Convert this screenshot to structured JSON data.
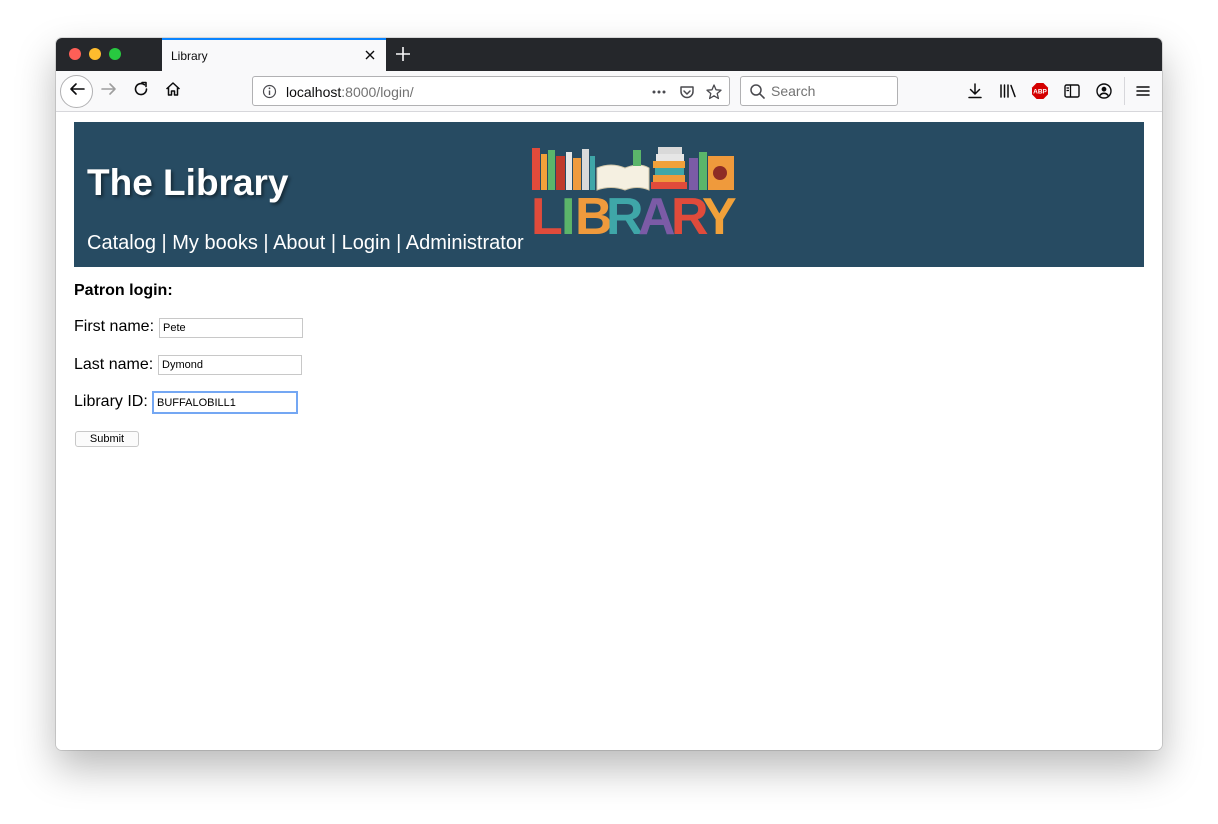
{
  "browser": {
    "tab": {
      "title": "Library"
    },
    "url": {
      "host": "localhost",
      "rest": ":8000/login/"
    },
    "search": {
      "placeholder": "Search"
    },
    "colors": {
      "tab_accent": "#0a84ff",
      "abp_red": "#d40000"
    }
  },
  "site": {
    "title": "The Library",
    "nav": [
      {
        "label": "Catalog"
      },
      {
        "label": "My books"
      },
      {
        "label": "About"
      },
      {
        "label": "Login"
      },
      {
        "label": "Administrator"
      }
    ],
    "nav_separator": " | ",
    "logo": {
      "text": "LIBRARY",
      "letters": [
        {
          "char": "L",
          "color": "#e04b3b"
        },
        {
          "char": "I",
          "color": "#5bb56a"
        },
        {
          "char": "B",
          "color": "#ef9a3c"
        },
        {
          "char": "R",
          "color": "#3fa6a8"
        },
        {
          "char": "A",
          "color": "#7b5ba6"
        },
        {
          "char": "R",
          "color": "#e04b3b"
        },
        {
          "char": "Y",
          "color": "#f1a13a"
        }
      ]
    },
    "header_color": "#274b62"
  },
  "form": {
    "title": "Patron login:",
    "fields": {
      "first_name": {
        "label": "First name:",
        "value": "Pete"
      },
      "last_name": {
        "label": "Last name:",
        "value": "Dymond"
      },
      "library_id": {
        "label": "Library ID:",
        "value": "BUFFALOBILL1"
      }
    },
    "submit_label": "Submit"
  }
}
